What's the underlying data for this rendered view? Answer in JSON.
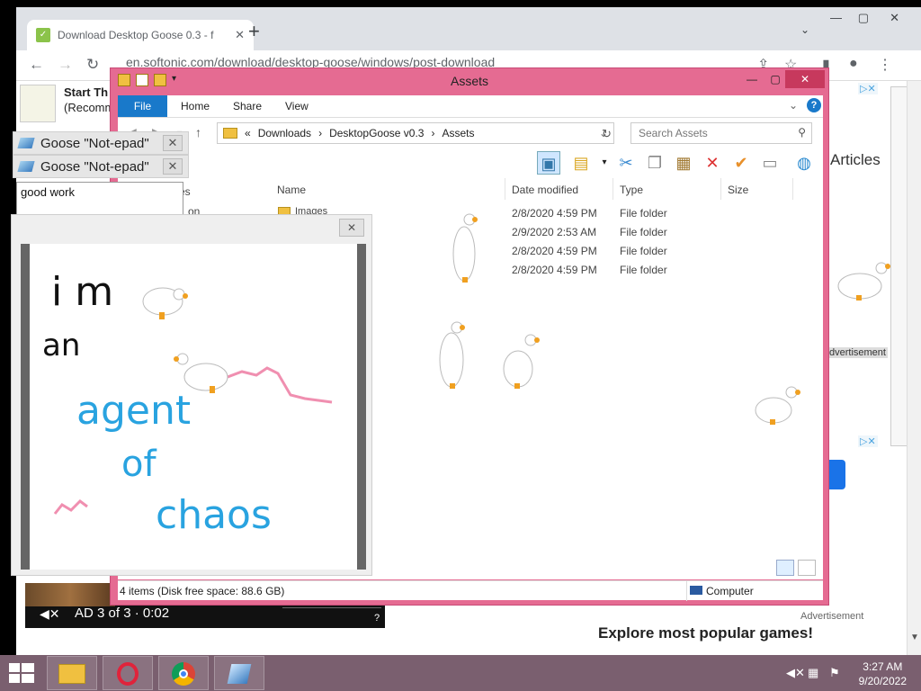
{
  "browser": {
    "tab_title": "Download Desktop Goose 0.3 - f",
    "url": "en.softonic.com/download/desktop-goose/windows/post-download",
    "new_tab": "+",
    "tab_close": "✕"
  },
  "page": {
    "banner_title": "Start Th",
    "banner_subtitle": "(Recomm",
    "articles": "Articles",
    "ad_badge": "▷✕",
    "ad_label": "dvertisement",
    "advertisement": "Advertisement",
    "explore": "Explore most popular games!",
    "video_ad": "AD 3 of 3 · 0:02"
  },
  "explorer": {
    "title": "Assets",
    "ribbon": {
      "file": "File",
      "home": "Home",
      "share": "Share",
      "view": "View"
    },
    "address": {
      "prefix": "«",
      "crumbs": [
        "Downloads",
        "DesktopGoose v0.3",
        "Assets"
      ]
    },
    "search_placeholder": "Search Assets",
    "columns": {
      "name": "Name",
      "date": "Date modified",
      "type": "Type",
      "size": "Size"
    },
    "partial_nav": [
      "es",
      "on"
    ],
    "rows": [
      {
        "name": "Images",
        "date": "2/8/2020 4:59 PM",
        "type": "File folder"
      },
      {
        "name": "",
        "date": "2/9/2020 2:53 AM",
        "type": "File folder"
      },
      {
        "name": "",
        "date": "2/8/2020 4:59 PM",
        "type": "File folder"
      },
      {
        "name": "",
        "date": "2/8/2020 4:59 PM",
        "type": "File folder"
      }
    ],
    "status_left": "4 items (Disk free space: 88.6 GB)",
    "status_right": "Computer"
  },
  "notes": [
    {
      "title": "Goose \"Not-epad\""
    },
    {
      "title": "Goose \"Not-epad\""
    }
  ],
  "note_text": "good work",
  "drawing_words": [
    "i m",
    "an",
    "agent",
    "of",
    "chaos"
  ],
  "taskbar": {
    "time": "3:27 AM",
    "date": "9/20/2022"
  },
  "colors": {
    "explorer_frame": "#e56b92",
    "ribbon_file": "#1979ca",
    "taskbar": "#7a5f6f",
    "ink_blue": "#29a3e0",
    "ink_pink": "#f08fb0"
  }
}
